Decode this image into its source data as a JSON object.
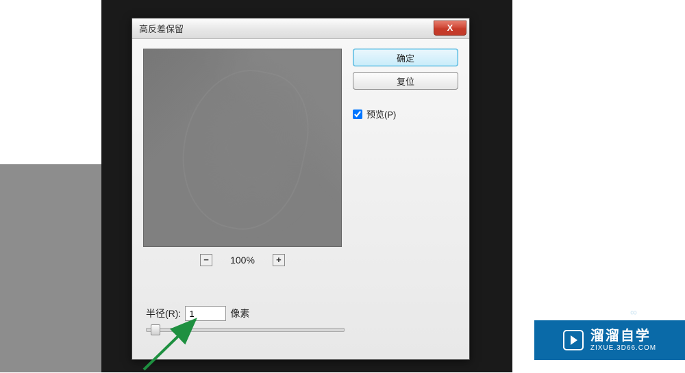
{
  "dialog": {
    "title": "高反差保留",
    "close_label": "X",
    "ok_label": "确定",
    "reset_label": "复位",
    "preview_checkbox_label": "预览(P)",
    "preview_checked": true,
    "zoom": {
      "minus": "−",
      "plus": "+",
      "level": "100%"
    },
    "radius": {
      "label": "半径(R):",
      "value": "1",
      "unit": "像素"
    }
  },
  "watermark": {
    "main": "溜溜自学",
    "sub": "ZIXUE.3D66.COM"
  }
}
